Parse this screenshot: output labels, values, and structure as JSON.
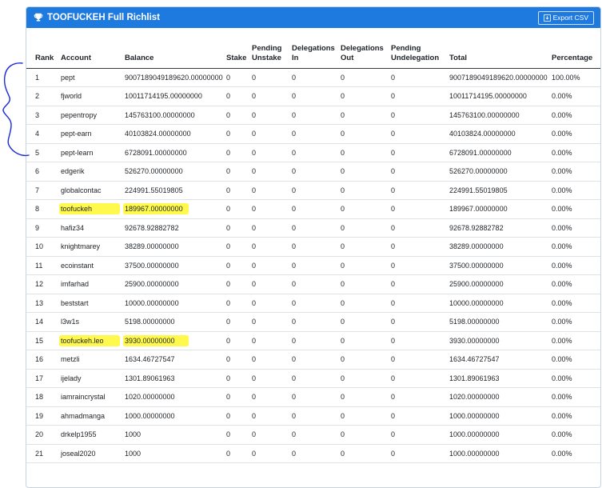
{
  "header": {
    "title": "TOOFUCKEH Full Richlist",
    "export_label": "Export CSV"
  },
  "columns": [
    "Rank",
    "Account",
    "Balance",
    "Stake",
    "Pending Unstake",
    "Delegations In",
    "Delegations Out",
    "Pending Undelegation",
    "Total",
    "Percentage"
  ],
  "rows": [
    {
      "rank": "1",
      "account": "pept",
      "balance": "9007189049189620.00000000",
      "stake": "0",
      "pending_unstake": "0",
      "delegations_in": "0",
      "delegations_out": "0",
      "pending_undelegation": "0",
      "total": "9007189049189620.00000000",
      "percentage": "100.00%"
    },
    {
      "rank": "2",
      "account": "fjworld",
      "balance": "10011714195.00000000",
      "stake": "0",
      "pending_unstake": "0",
      "delegations_in": "0",
      "delegations_out": "0",
      "pending_undelegation": "0",
      "total": "10011714195.00000000",
      "percentage": "0.00%"
    },
    {
      "rank": "3",
      "account": "pepentropy",
      "balance": "145763100.00000000",
      "stake": "0",
      "pending_unstake": "0",
      "delegations_in": "0",
      "delegations_out": "0",
      "pending_undelegation": "0",
      "total": "145763100.00000000",
      "percentage": "0.00%"
    },
    {
      "rank": "4",
      "account": "pept-earn",
      "balance": "40103824.00000000",
      "stake": "0",
      "pending_unstake": "0",
      "delegations_in": "0",
      "delegations_out": "0",
      "pending_undelegation": "0",
      "total": "40103824.00000000",
      "percentage": "0.00%"
    },
    {
      "rank": "5",
      "account": "pept-learn",
      "balance": "6728091.00000000",
      "stake": "0",
      "pending_unstake": "0",
      "delegations_in": "0",
      "delegations_out": "0",
      "pending_undelegation": "0",
      "total": "6728091.00000000",
      "percentage": "0.00%"
    },
    {
      "rank": "6",
      "account": "edgerik",
      "balance": "526270.00000000",
      "stake": "0",
      "pending_unstake": "0",
      "delegations_in": "0",
      "delegations_out": "0",
      "pending_undelegation": "0",
      "total": "526270.00000000",
      "percentage": "0.00%"
    },
    {
      "rank": "7",
      "account": "globalcontac",
      "balance": "224991.55019805",
      "stake": "0",
      "pending_unstake": "0",
      "delegations_in": "0",
      "delegations_out": "0",
      "pending_undelegation": "0",
      "total": "224991.55019805",
      "percentage": "0.00%"
    },
    {
      "rank": "8",
      "account": "toofuckeh",
      "balance": "189967.00000000",
      "stake": "0",
      "pending_unstake": "0",
      "delegations_in": "0",
      "delegations_out": "0",
      "pending_undelegation": "0",
      "total": "189967.00000000",
      "percentage": "0.00%",
      "highlight": true
    },
    {
      "rank": "9",
      "account": "hafiz34",
      "balance": "92678.92882782",
      "stake": "0",
      "pending_unstake": "0",
      "delegations_in": "0",
      "delegations_out": "0",
      "pending_undelegation": "0",
      "total": "92678.92882782",
      "percentage": "0.00%"
    },
    {
      "rank": "10",
      "account": "knightmarey",
      "balance": "38289.00000000",
      "stake": "0",
      "pending_unstake": "0",
      "delegations_in": "0",
      "delegations_out": "0",
      "pending_undelegation": "0",
      "total": "38289.00000000",
      "percentage": "0.00%"
    },
    {
      "rank": "11",
      "account": "ecoinstant",
      "balance": "37500.00000000",
      "stake": "0",
      "pending_unstake": "0",
      "delegations_in": "0",
      "delegations_out": "0",
      "pending_undelegation": "0",
      "total": "37500.00000000",
      "percentage": "0.00%"
    },
    {
      "rank": "12",
      "account": "imfarhad",
      "balance": "25900.00000000",
      "stake": "0",
      "pending_unstake": "0",
      "delegations_in": "0",
      "delegations_out": "0",
      "pending_undelegation": "0",
      "total": "25900.00000000",
      "percentage": "0.00%"
    },
    {
      "rank": "13",
      "account": "beststart",
      "balance": "10000.00000000",
      "stake": "0",
      "pending_unstake": "0",
      "delegations_in": "0",
      "delegations_out": "0",
      "pending_undelegation": "0",
      "total": "10000.00000000",
      "percentage": "0.00%"
    },
    {
      "rank": "14",
      "account": "l3w1s",
      "balance": "5198.00000000",
      "stake": "0",
      "pending_unstake": "0",
      "delegations_in": "0",
      "delegations_out": "0",
      "pending_undelegation": "0",
      "total": "5198.00000000",
      "percentage": "0.00%"
    },
    {
      "rank": "15",
      "account": "toofuckeh.leo",
      "balance": "3930.00000000",
      "stake": "0",
      "pending_unstake": "0",
      "delegations_in": "0",
      "delegations_out": "0",
      "pending_undelegation": "0",
      "total": "3930.00000000",
      "percentage": "0.00%",
      "highlight": true
    },
    {
      "rank": "16",
      "account": "metzli",
      "balance": "1634.46727547",
      "stake": "0",
      "pending_unstake": "0",
      "delegations_in": "0",
      "delegations_out": "0",
      "pending_undelegation": "0",
      "total": "1634.46727547",
      "percentage": "0.00%"
    },
    {
      "rank": "17",
      "account": "ijelady",
      "balance": "1301.89061963",
      "stake": "0",
      "pending_unstake": "0",
      "delegations_in": "0",
      "delegations_out": "0",
      "pending_undelegation": "0",
      "total": "1301.89061963",
      "percentage": "0.00%"
    },
    {
      "rank": "18",
      "account": "iamraincrystal",
      "balance": "1020.00000000",
      "stake": "0",
      "pending_unstake": "0",
      "delegations_in": "0",
      "delegations_out": "0",
      "pending_undelegation": "0",
      "total": "1020.00000000",
      "percentage": "0.00%"
    },
    {
      "rank": "19",
      "account": "ahmadmanga",
      "balance": "1000.00000000",
      "stake": "0",
      "pending_unstake": "0",
      "delegations_in": "0",
      "delegations_out": "0",
      "pending_undelegation": "0",
      "total": "1000.00000000",
      "percentage": "0.00%"
    },
    {
      "rank": "20",
      "account": "drkelp1955",
      "balance": "1000",
      "stake": "0",
      "pending_unstake": "0",
      "delegations_in": "0",
      "delegations_out": "0",
      "pending_undelegation": "0",
      "total": "1000.00000000",
      "percentage": "0.00%"
    },
    {
      "rank": "21",
      "account": "joseal2020",
      "balance": "1000",
      "stake": "0",
      "pending_unstake": "0",
      "delegations_in": "0",
      "delegations_out": "0",
      "pending_undelegation": "0",
      "total": "1000.00000000",
      "percentage": "0.00%"
    }
  ],
  "colors": {
    "header_bg": "#1f7ae0",
    "highlight": "#fff94d",
    "annotation_ink": "#1a2ad6"
  },
  "icons": {
    "title": "trophy-icon",
    "export": "download-icon"
  }
}
